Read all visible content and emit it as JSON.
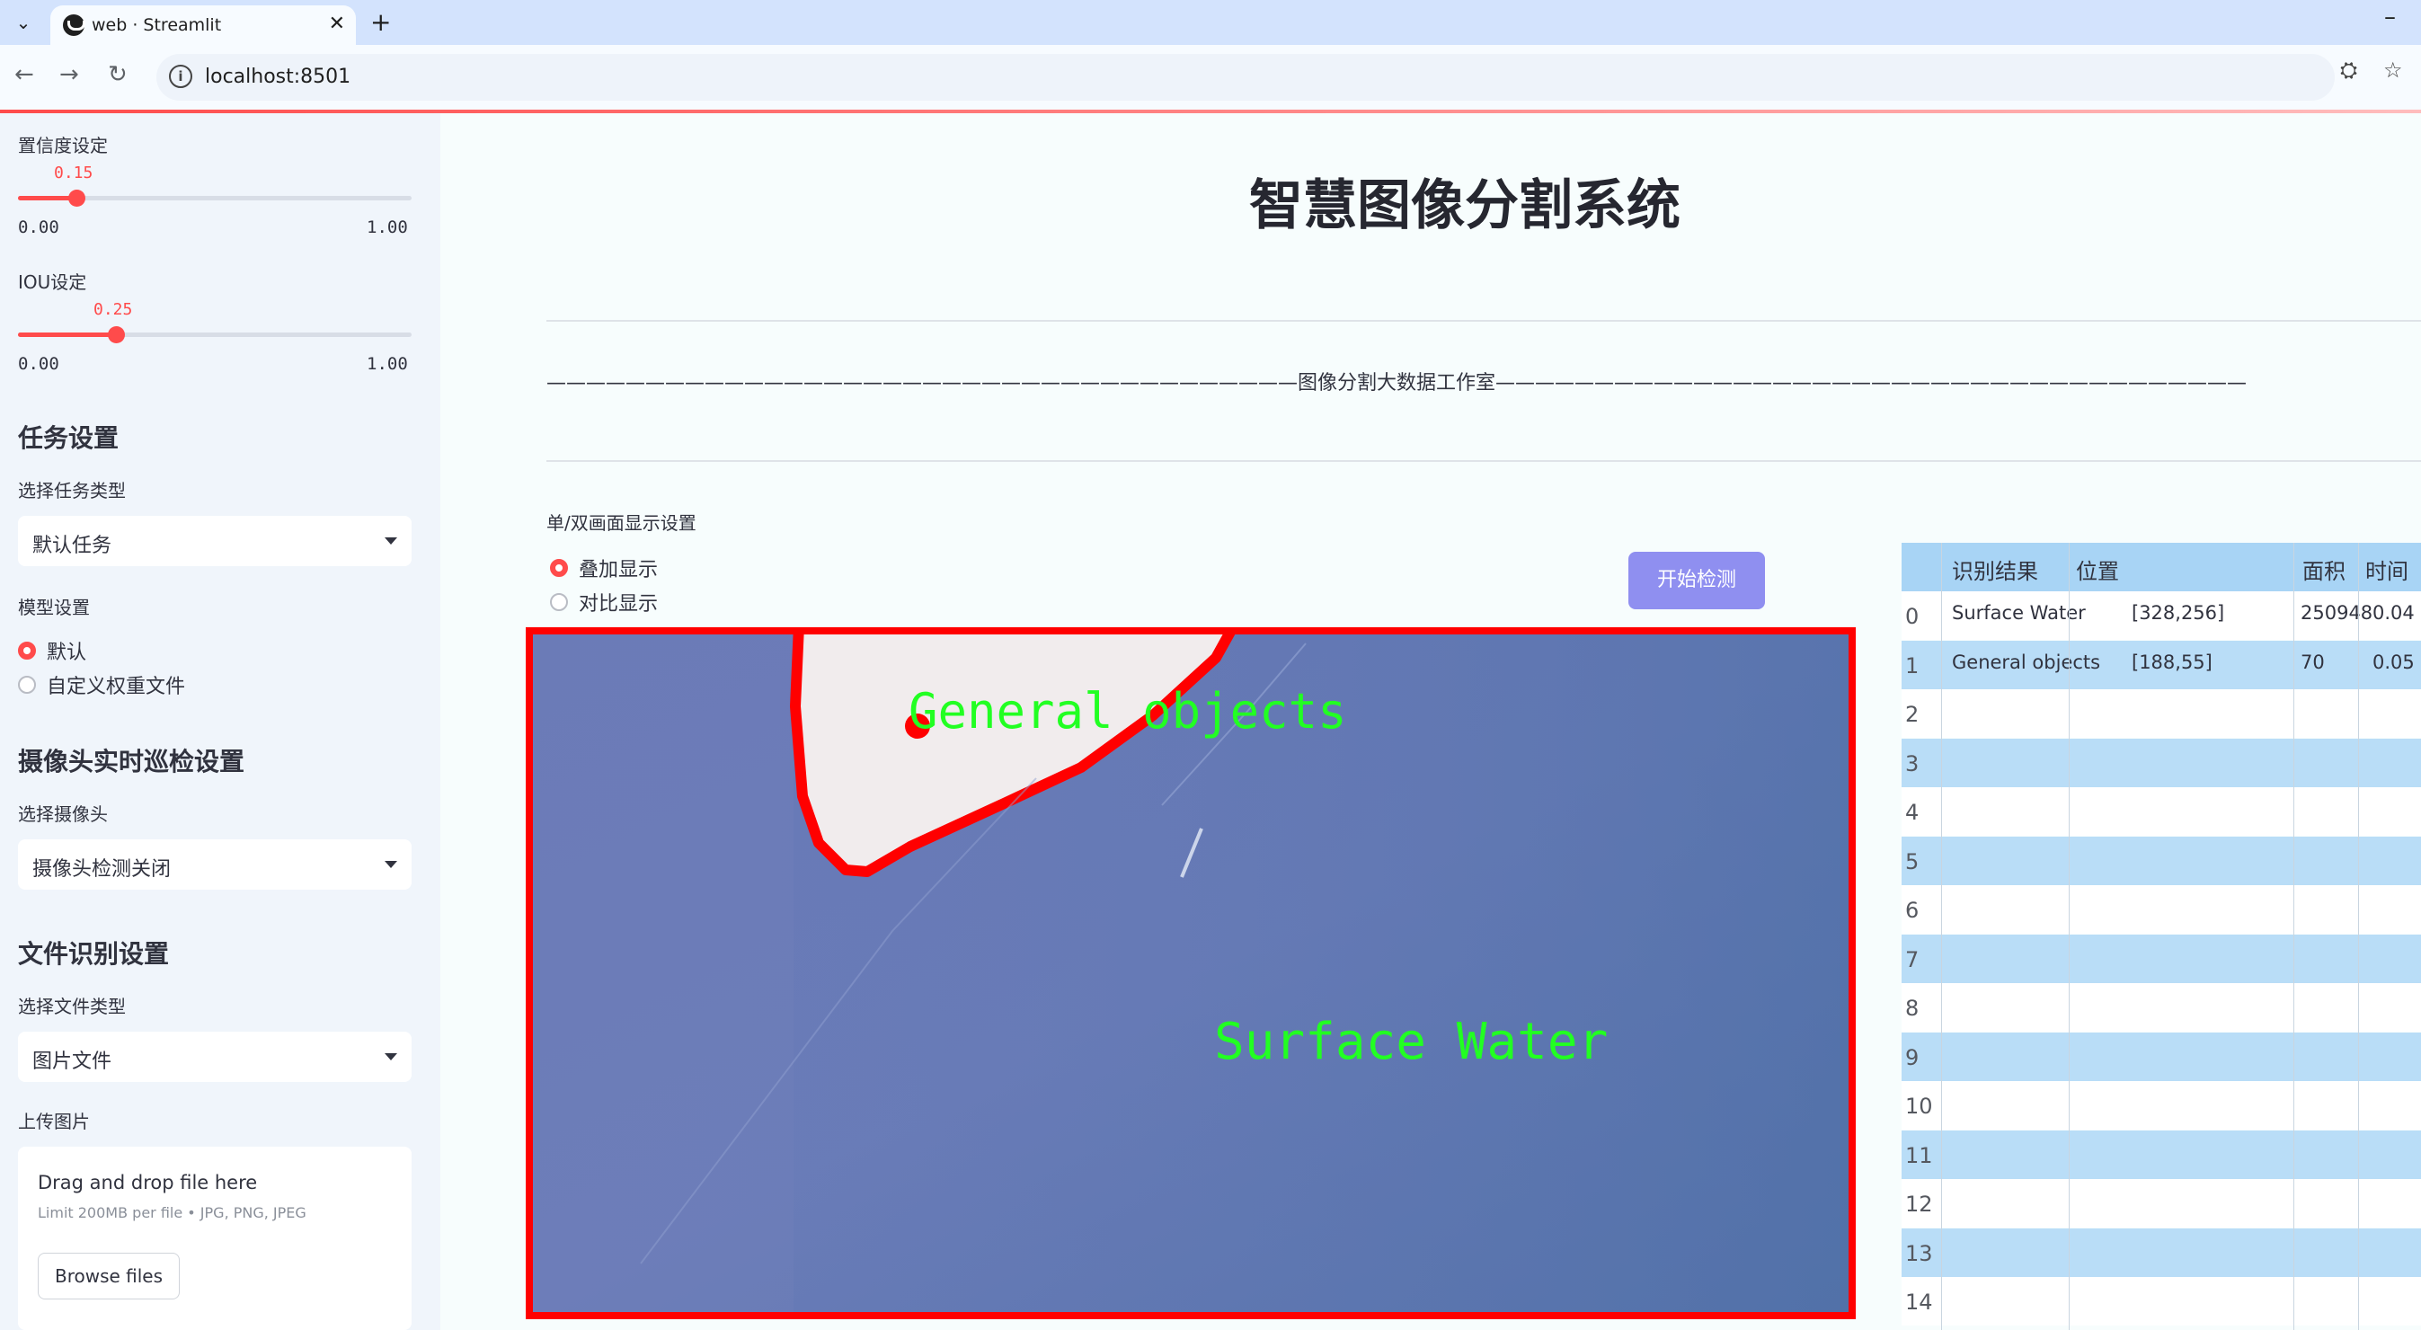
{
  "browser": {
    "tab_title": "web · Streamlit",
    "url": "localhost:8501"
  },
  "sidebar": {
    "confidence": {
      "label": "置信度设定",
      "value": "0.15",
      "value_num": 0.15,
      "min": "0.00",
      "max": "1.00"
    },
    "iou": {
      "label": "IOU设定",
      "value": "0.25",
      "value_num": 0.25,
      "min": "0.00",
      "max": "1.00"
    },
    "task_heading": "任务设置",
    "task_type_label": "选择任务类型",
    "task_type_value": "默认任务",
    "model_label": "模型设置",
    "model_options": [
      "默认",
      "自定义权重文件"
    ],
    "camera_heading": "摄像头实时巡检设置",
    "camera_label": "选择摄像头",
    "camera_value": "摄像头检测关闭",
    "file_heading": "文件识别设置",
    "file_type_label": "选择文件类型",
    "file_type_value": "图片文件",
    "upload_label": "上传图片",
    "upload_title": "Drag and drop file here",
    "upload_limit": "Limit 200MB per file • JPG, PNG, JPEG",
    "upload_button": "Browse files"
  },
  "main": {
    "title": "智慧图像分割系统",
    "banner": "——————————————————————————————————————图像分割大数据工作室——————————————————————————————————————",
    "display_mode_label": "单/双画面显示设置",
    "display_modes": [
      "叠加显示",
      "对比显示"
    ],
    "start_button": "开始检测",
    "image_labels": [
      "General objects",
      "Surface Water"
    ]
  },
  "table": {
    "headers": [
      "识别结果",
      "位置",
      "面积",
      "时间"
    ],
    "rows": [
      {
        "index": "0",
        "result": "Surface Water",
        "position": "[328,256]",
        "area": "250948",
        "time": "0.04"
      },
      {
        "index": "1",
        "result": "General objects",
        "position": "[188,55]",
        "area": "70",
        "time": "0.05"
      },
      {
        "index": "2"
      },
      {
        "index": "3"
      },
      {
        "index": "4"
      },
      {
        "index": "5"
      },
      {
        "index": "6"
      },
      {
        "index": "7"
      },
      {
        "index": "8"
      },
      {
        "index": "9"
      },
      {
        "index": "10"
      },
      {
        "index": "11"
      },
      {
        "index": "12"
      },
      {
        "index": "13"
      },
      {
        "index": "14"
      }
    ]
  },
  "colors": {
    "accent": "#ff4b4b",
    "button": "#8f8ff0",
    "label_green": "#22ff22",
    "mask_red": "#ff0000"
  }
}
